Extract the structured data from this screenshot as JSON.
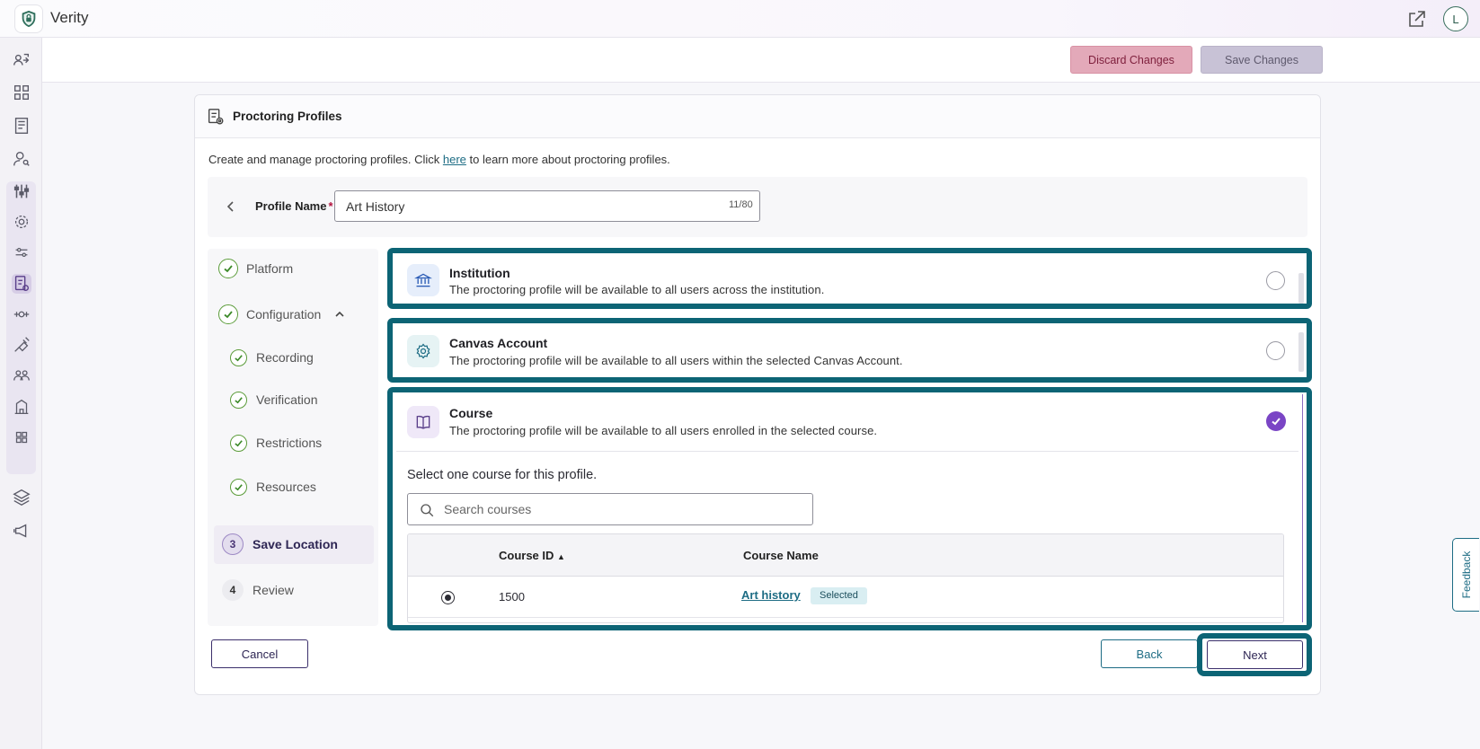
{
  "app": {
    "title": "Verity",
    "avatar_initial": "L"
  },
  "toolbar": {
    "discard_label": "Discard Changes",
    "save_label": "Save Changes"
  },
  "card": {
    "title": "Proctoring Profiles",
    "intro_prefix": "Create and manage proctoring profiles. Click ",
    "intro_link": "here",
    "intro_suffix": " to learn more about proctoring profiles."
  },
  "profile_name": {
    "label": "Profile Name",
    "required_mark": "*",
    "value": "Art History",
    "counter": "11/80"
  },
  "steps": [
    {
      "label": "Platform",
      "state": "done"
    },
    {
      "label": "Configuration",
      "state": "done"
    },
    {
      "label": "Recording",
      "state": "done"
    },
    {
      "label": "Verification",
      "state": "done"
    },
    {
      "label": "Restrictions",
      "state": "done"
    },
    {
      "label": "Resources",
      "state": "done"
    },
    {
      "number": "3",
      "label": "Save Location",
      "state": "active"
    },
    {
      "number": "4",
      "label": "Review",
      "state": "pending"
    }
  ],
  "locations": [
    {
      "title": "Institution",
      "description": "The proctoring profile will be available to all users across the institution.",
      "selected": false,
      "icon": "institution-icon"
    },
    {
      "title": "Canvas Account",
      "description": "The proctoring profile will be available to all users within the selected Canvas Account.",
      "selected": false,
      "icon": "settings-icon"
    },
    {
      "title": "Course",
      "description": "The proctoring profile will be available to all users enrolled in the selected course.",
      "selected": true,
      "icon": "book-icon"
    }
  ],
  "course_picker": {
    "instruction": "Select one course for this profile.",
    "search_placeholder": "Search courses",
    "columns": {
      "course_id": "Course ID",
      "sort_indicator": "▲",
      "course_name": "Course Name"
    },
    "rows": [
      {
        "course_id": "1500",
        "course_name": "Art history",
        "badge": "Selected"
      }
    ]
  },
  "footer": {
    "cancel_label": "Cancel",
    "back_label": "Back",
    "next_label": "Next"
  },
  "feedback_label": "Feedback",
  "colors": {
    "highlight": "#0c6475",
    "accent_purple": "#7a45c5",
    "link": "#1d6c84",
    "success_green": "#3d8a2a"
  }
}
